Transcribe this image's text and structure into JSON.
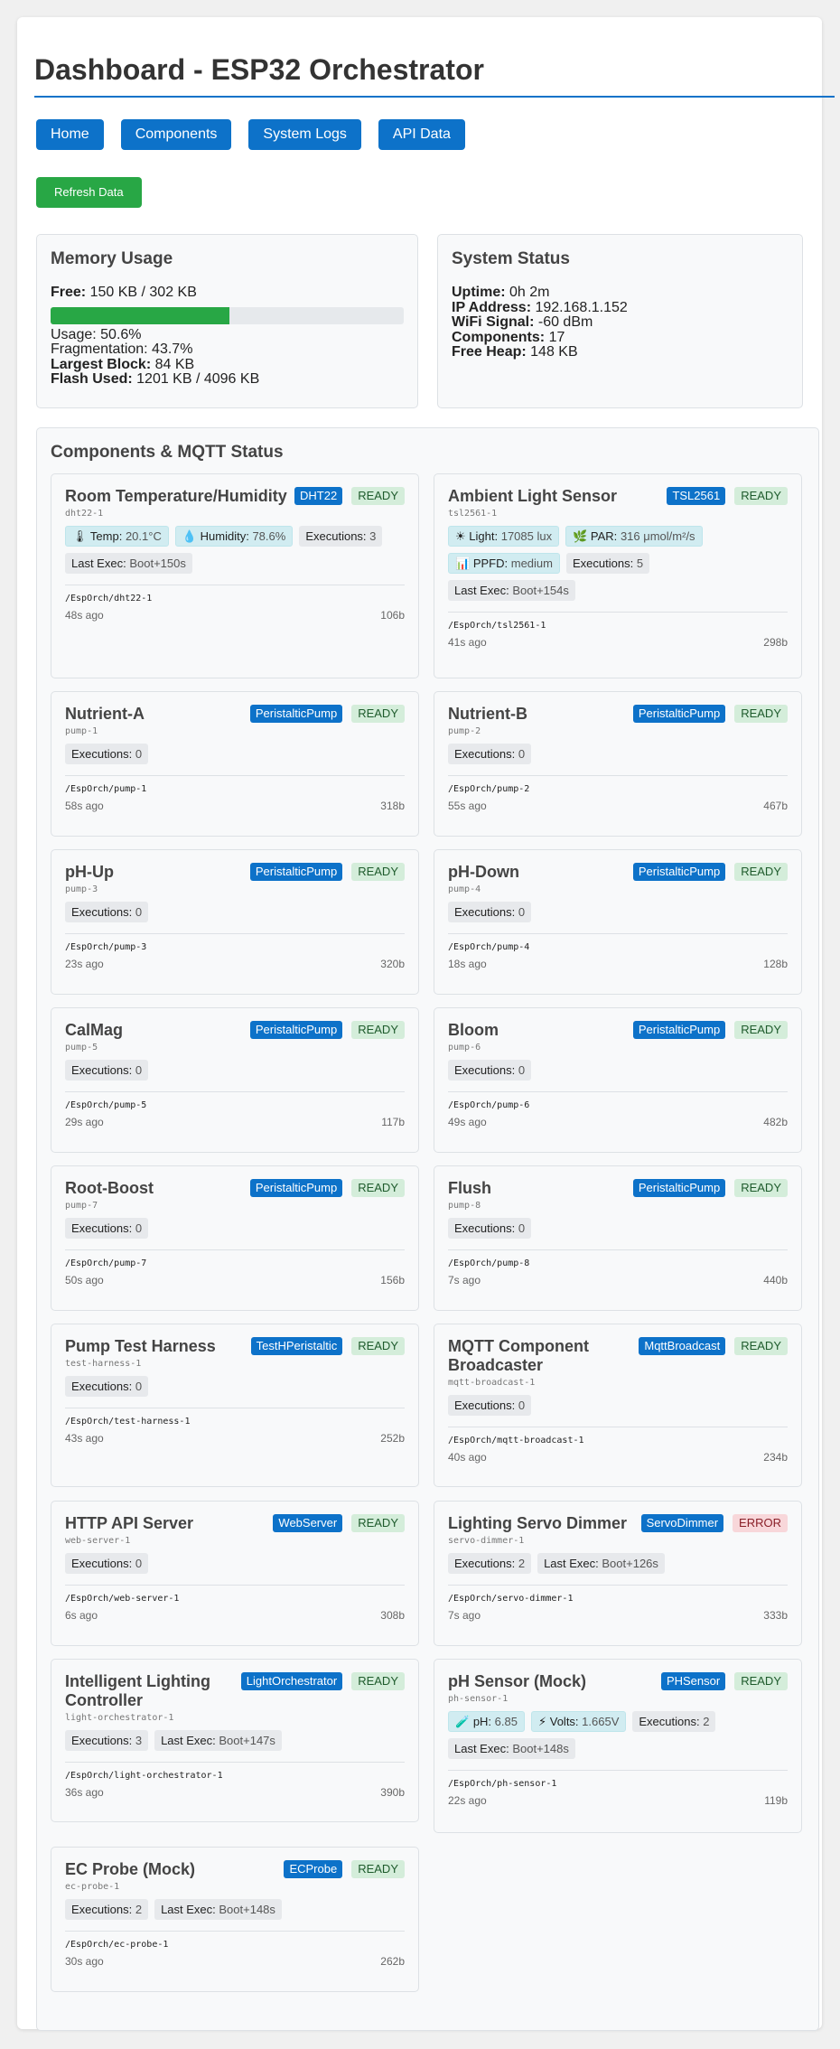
{
  "page": {
    "title": "Dashboard - ESP32 Orchestrator"
  },
  "nav": [
    {
      "label": "Home"
    },
    {
      "label": "Components"
    },
    {
      "label": "System Logs"
    },
    {
      "label": "API Data"
    }
  ],
  "refresh_label": "Refresh Data",
  "memory": {
    "heading": "Memory Usage",
    "free_label": "Free:",
    "free_value": "150 KB / 302 KB",
    "usage_fraction": 0.506,
    "usage_text": "Usage: 50.6%",
    "fragmentation_text": "Fragmentation: 43.7%",
    "largest_label": "Largest Block:",
    "largest_value": "84 KB",
    "flash_label": "Flash Used:",
    "flash_value": "1201 KB / 4096 KB"
  },
  "system": {
    "heading": "System Status",
    "rows": [
      {
        "label": "Uptime:",
        "value": "0h 2m"
      },
      {
        "label": "IP Address:",
        "value": "192.168.1.152"
      },
      {
        "label": "WiFi Signal:",
        "value": "-60 dBm"
      },
      {
        "label": "Components:",
        "value": "17"
      },
      {
        "label": "Free Heap:",
        "value": "148 KB"
      }
    ]
  },
  "components_heading": "Components & MQTT Status",
  "components": [
    {
      "name": "Room Temperature/Humidity",
      "type": "DHT22",
      "status": "READY",
      "id": "dht22-1",
      "chips": [
        {
          "kind": "sensor",
          "icon": "thermometer-icon",
          "glyph": "🌡",
          "label": "Temp:",
          "value": "20.1°C"
        },
        {
          "kind": "sensor",
          "icon": "droplet-icon",
          "glyph": "💧",
          "label": "Humidity:",
          "value": "78.6%"
        },
        {
          "kind": "plain",
          "label": "Executions:",
          "value": "3"
        },
        {
          "kind": "plain",
          "label": "Last Exec:",
          "value": "Boot+150s"
        }
      ],
      "topic": "/EspOrch/dht22-1",
      "ago": "48s ago",
      "size": "106b"
    },
    {
      "name": "Ambient Light Sensor",
      "type": "TSL2561",
      "status": "READY",
      "id": "tsl2561-1",
      "chips": [
        {
          "kind": "sensor",
          "icon": "sun-icon",
          "glyph": "☀",
          "label": "Light:",
          "value": "17085 lux"
        },
        {
          "kind": "sensor",
          "icon": "leaf-icon",
          "glyph": "🌿",
          "label": "PAR:",
          "value": "316 μmol/m²/s"
        },
        {
          "kind": "sensor",
          "icon": "chart-icon",
          "glyph": "📊",
          "label": "PPFD:",
          "value": "medium"
        },
        {
          "kind": "plain",
          "label": "Executions:",
          "value": "5"
        },
        {
          "kind": "plain",
          "label": "Last Exec:",
          "value": "Boot+154s"
        }
      ],
      "topic": "/EspOrch/tsl2561-1",
      "ago": "41s ago",
      "size": "298b"
    },
    {
      "name": "Nutrient-A",
      "type": "PeristalticPump",
      "status": "READY",
      "id": "pump-1",
      "chips": [
        {
          "kind": "plain",
          "label": "Executions:",
          "value": "0"
        }
      ],
      "topic": "/EspOrch/pump-1",
      "ago": "58s ago",
      "size": "318b"
    },
    {
      "name": "Nutrient-B",
      "type": "PeristalticPump",
      "status": "READY",
      "id": "pump-2",
      "chips": [
        {
          "kind": "plain",
          "label": "Executions:",
          "value": "0"
        }
      ],
      "topic": "/EspOrch/pump-2",
      "ago": "55s ago",
      "size": "467b"
    },
    {
      "name": "pH-Up",
      "type": "PeristalticPump",
      "status": "READY",
      "id": "pump-3",
      "chips": [
        {
          "kind": "plain",
          "label": "Executions:",
          "value": "0"
        }
      ],
      "topic": "/EspOrch/pump-3",
      "ago": "23s ago",
      "size": "320b"
    },
    {
      "name": "pH-Down",
      "type": "PeristalticPump",
      "status": "READY",
      "id": "pump-4",
      "chips": [
        {
          "kind": "plain",
          "label": "Executions:",
          "value": "0"
        }
      ],
      "topic": "/EspOrch/pump-4",
      "ago": "18s ago",
      "size": "128b"
    },
    {
      "name": "CalMag",
      "type": "PeristalticPump",
      "status": "READY",
      "id": "pump-5",
      "chips": [
        {
          "kind": "plain",
          "label": "Executions:",
          "value": "0"
        }
      ],
      "topic": "/EspOrch/pump-5",
      "ago": "29s ago",
      "size": "117b"
    },
    {
      "name": "Bloom",
      "type": "PeristalticPump",
      "status": "READY",
      "id": "pump-6",
      "chips": [
        {
          "kind": "plain",
          "label": "Executions:",
          "value": "0"
        }
      ],
      "topic": "/EspOrch/pump-6",
      "ago": "49s ago",
      "size": "482b"
    },
    {
      "name": "Root-Boost",
      "type": "PeristalticPump",
      "status": "READY",
      "id": "pump-7",
      "chips": [
        {
          "kind": "plain",
          "label": "Executions:",
          "value": "0"
        }
      ],
      "topic": "/EspOrch/pump-7",
      "ago": "50s ago",
      "size": "156b"
    },
    {
      "name": "Flush",
      "type": "PeristalticPump",
      "status": "READY",
      "id": "pump-8",
      "chips": [
        {
          "kind": "plain",
          "label": "Executions:",
          "value": "0"
        }
      ],
      "topic": "/EspOrch/pump-8",
      "ago": "7s ago",
      "size": "440b"
    },
    {
      "name": "Pump Test Harness",
      "type": "TestHPeristaltic",
      "status": "READY",
      "id": "test-harness-1",
      "chips": [
        {
          "kind": "plain",
          "label": "Executions:",
          "value": "0"
        }
      ],
      "topic": "/EspOrch/test-harness-1",
      "ago": "43s ago",
      "size": "252b"
    },
    {
      "name": "MQTT Component Broadcaster",
      "type": "MqttBroadcast",
      "status": "READY",
      "id": "mqtt-broadcast-1",
      "chips": [
        {
          "kind": "plain",
          "label": "Executions:",
          "value": "0"
        }
      ],
      "topic": "/EspOrch/mqtt-broadcast-1",
      "ago": "40s ago",
      "size": "234b"
    },
    {
      "name": "HTTP API Server",
      "type": "WebServer",
      "status": "READY",
      "id": "web-server-1",
      "chips": [
        {
          "kind": "plain",
          "label": "Executions:",
          "value": "0"
        }
      ],
      "topic": "/EspOrch/web-server-1",
      "ago": "6s ago",
      "size": "308b"
    },
    {
      "name": "Lighting Servo Dimmer",
      "type": "ServoDimmer",
      "status": "ERROR",
      "id": "servo-dimmer-1",
      "chips": [
        {
          "kind": "plain",
          "label": "Executions:",
          "value": "2"
        },
        {
          "kind": "plain",
          "label": "Last Exec:",
          "value": "Boot+126s"
        }
      ],
      "topic": "/EspOrch/servo-dimmer-1",
      "ago": "7s ago",
      "size": "333b"
    },
    {
      "name": "Intelligent Lighting Controller",
      "type": "LightOrchestrator",
      "status": "READY",
      "id": "light-orchestrator-1",
      "chips": [
        {
          "kind": "plain",
          "label": "Executions:",
          "value": "3"
        },
        {
          "kind": "plain",
          "label": "Last Exec:",
          "value": "Boot+147s"
        }
      ],
      "topic": "/EspOrch/light-orchestrator-1",
      "ago": "36s ago",
      "size": "390b"
    },
    {
      "name": "pH Sensor (Mock)",
      "type": "PHSensor",
      "status": "READY",
      "id": "ph-sensor-1",
      "chips": [
        {
          "kind": "sensor",
          "icon": "test-tube-icon",
          "glyph": "🧪",
          "label": "pH:",
          "value": "6.85"
        },
        {
          "kind": "sensor",
          "icon": "lightning-icon",
          "glyph": "⚡",
          "label": "Volts:",
          "value": "1.665V"
        },
        {
          "kind": "plain",
          "label": "Executions:",
          "value": "2"
        },
        {
          "kind": "plain",
          "label": "Last Exec:",
          "value": "Boot+148s"
        }
      ],
      "topic": "/EspOrch/ph-sensor-1",
      "ago": "22s ago",
      "size": "119b"
    },
    {
      "name": "EC Probe (Mock)",
      "type": "ECProbe",
      "status": "READY",
      "id": "ec-probe-1",
      "chips": [
        {
          "kind": "plain",
          "label": "Executions:",
          "value": "2"
        },
        {
          "kind": "plain",
          "label": "Last Exec:",
          "value": "Boot+148s"
        }
      ],
      "topic": "/EspOrch/ec-probe-1",
      "ago": "30s ago",
      "size": "262b"
    }
  ]
}
